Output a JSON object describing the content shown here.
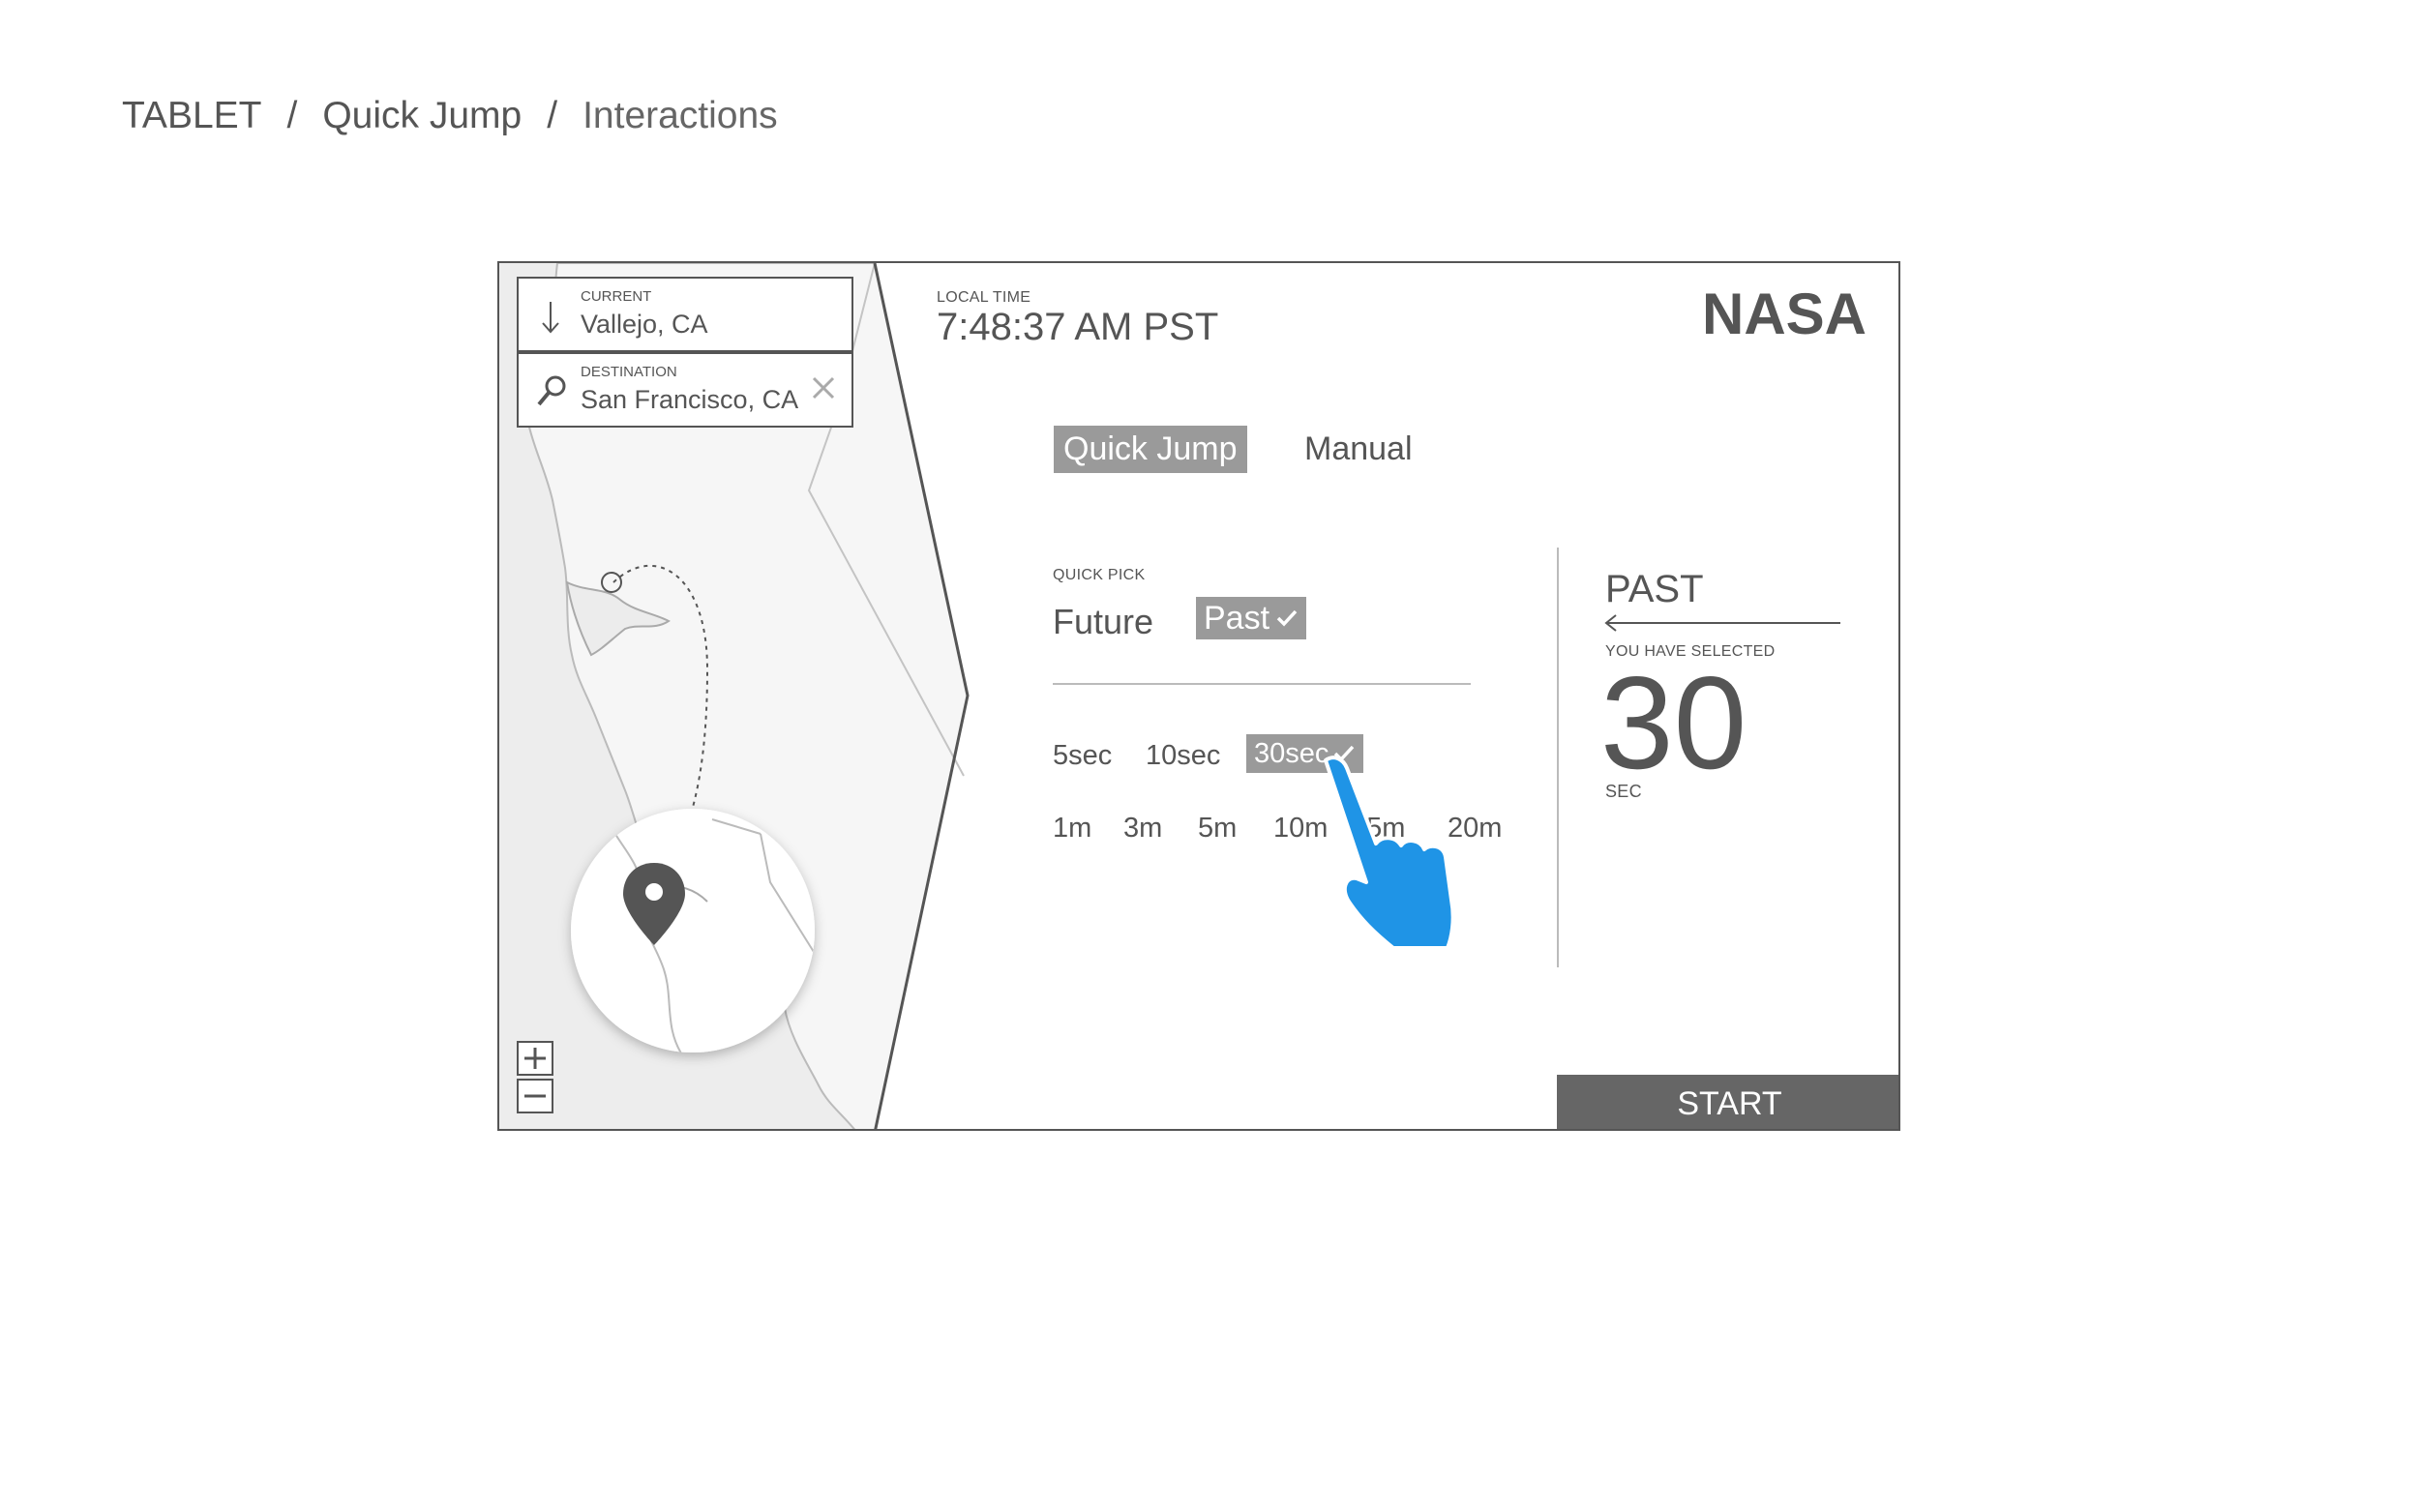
{
  "breadcrumb": {
    "items": [
      "TABLET",
      "Quick Jump",
      "Interactions"
    ],
    "separator": "/"
  },
  "map": {
    "current": {
      "label": "CURRENT",
      "value": "Vallejo, CA"
    },
    "destination": {
      "label": "DESTINATION",
      "value": "San Francisco, CA"
    },
    "zoom_in": "+",
    "zoom_out": "−"
  },
  "header": {
    "local_time_label": "LOCAL TIME",
    "local_time": "7:48:37 AM PST",
    "logo": "NASA"
  },
  "mode_tabs": [
    {
      "label": "Quick Jump",
      "selected": true
    },
    {
      "label": "Manual",
      "selected": false
    }
  ],
  "quick_pick": {
    "label": "QUICK PICK",
    "direction_options": [
      {
        "label": "Future",
        "selected": false
      },
      {
        "label": "Past",
        "selected": true
      }
    ],
    "seconds_options": [
      {
        "label": "5sec",
        "selected": false
      },
      {
        "label": "10sec",
        "selected": false
      },
      {
        "label": "30sec",
        "selected": true
      }
    ],
    "minute_options": [
      {
        "label": "1m"
      },
      {
        "label": "3m"
      },
      {
        "label": "5m"
      },
      {
        "label": "10m"
      },
      {
        "label": "15m"
      },
      {
        "label": "20m"
      }
    ]
  },
  "summary": {
    "direction": "PAST",
    "selected_label": "YOU HAVE SELECTED",
    "value": "30",
    "unit": "SEC"
  },
  "start_label": "START",
  "colors": {
    "accent_hand": "#1f94e6",
    "selected_pill": "#9a9a9a",
    "start_button": "#666666"
  },
  "icons": [
    "down-arrow-icon",
    "search-icon",
    "close-icon",
    "map-pin-icon",
    "checkmark-icon",
    "left-arrow-icon",
    "pointing-hand-icon"
  ]
}
